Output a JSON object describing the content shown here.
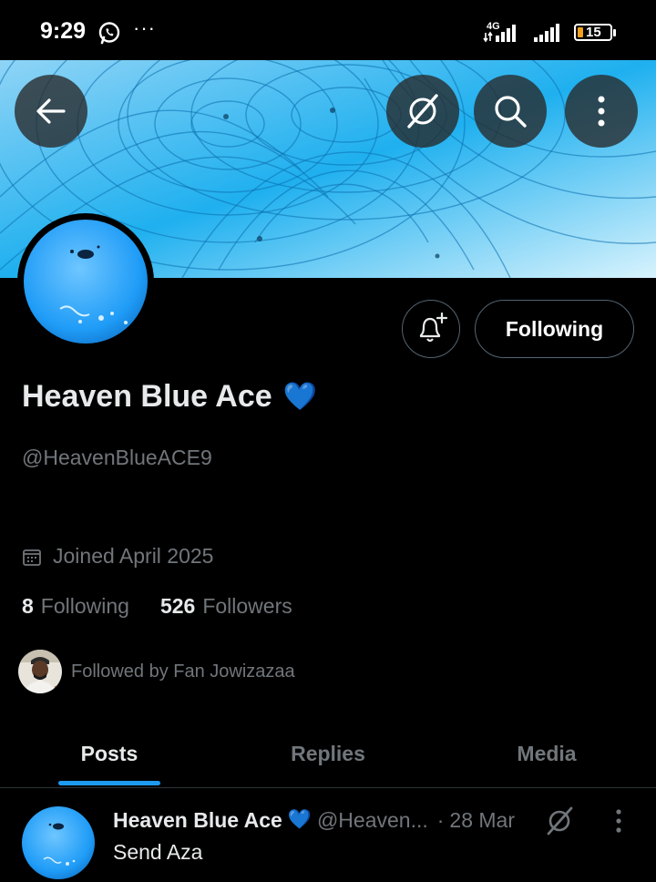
{
  "status_bar": {
    "time": "9:29",
    "network": "4G",
    "battery": "15",
    "more": "···"
  },
  "header": {
    "back_icon": "arrow-left-icon",
    "grok_icon": "grok-icon",
    "search_icon": "search-icon",
    "more_icon": "more-vertical-icon"
  },
  "profile": {
    "display_name": "Heaven Blue Ace",
    "verified_emoji": "💙",
    "handle": "@HeavenBlueACE9",
    "joined": "Joined April 2025",
    "following_count": "8",
    "following_label": "Following",
    "followers_count": "526",
    "followers_label": "Followers",
    "followed_by": "Followed by Fan Jowizazaa",
    "follow_button_label": "Following"
  },
  "tabs": [
    {
      "label": "Posts",
      "active": true
    },
    {
      "label": "Replies",
      "active": false
    },
    {
      "label": "Media",
      "active": false
    }
  ],
  "post": {
    "author_name": "Heaven Blue Ace",
    "author_emoji": "💙",
    "author_handle": "@Heaven...",
    "separator": "·",
    "date": "28 Mar",
    "text": "Send Aza"
  },
  "colors": {
    "accent": "#1d9bf0",
    "background": "#000000",
    "muted_text": "#71767b",
    "heart_blue": "#2b8cea"
  }
}
